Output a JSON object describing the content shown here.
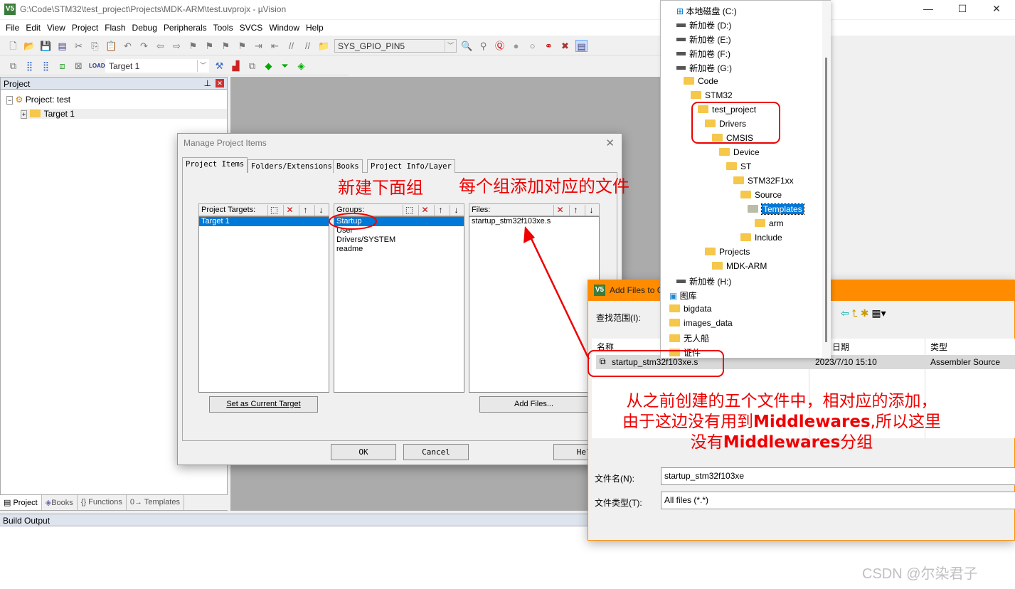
{
  "window": {
    "title": "G:\\Code\\STM32\\test_project\\Projects\\MDK-ARM\\test.uvprojx - µVision",
    "app_icon": "V5",
    "controls": [
      "minimize",
      "maximize",
      "close"
    ]
  },
  "menu": [
    "File",
    "Edit",
    "View",
    "Project",
    "Flash",
    "Debug",
    "Peripherals",
    "Tools",
    "SVCS",
    "Window",
    "Help"
  ],
  "toolbar": {
    "find_combo": "SYS_GPIO_PIN5",
    "target_combo": "Target 1",
    "load_label": "LOAD"
  },
  "project_pane": {
    "title": "Project",
    "root": "Project: test",
    "target": "Target 1",
    "tabs": [
      "Project",
      "Books",
      "{} Functions",
      "0→ Templates"
    ]
  },
  "build_output": {
    "title": "Build Output"
  },
  "manage_dialog": {
    "title": "Manage Project Items",
    "tabs": [
      "Project Items",
      "Folders/Extensions",
      "Books",
      "Project Info/Layer"
    ],
    "targets_label": "Project Targets:",
    "targets": [
      "Target 1"
    ],
    "groups_label": "Groups:",
    "groups": [
      "Startup",
      "User",
      "Drivers/SYSTEM",
      "readme"
    ],
    "files_label": "Files:",
    "files": [
      "startup_stm32f103xe.s"
    ],
    "set_target_btn": "Set as Current Target",
    "add_files_btn": "Add Files...",
    "ok": "OK",
    "cancel": "Cancel",
    "help": "Help"
  },
  "folder_tree": [
    {
      "label": "本地磁盘 (C:)",
      "icon": "windows-drive"
    },
    {
      "label": "新加卷 (D:)",
      "icon": "drive"
    },
    {
      "label": "新加卷 (E:)",
      "icon": "drive"
    },
    {
      "label": "新加卷 (F:)",
      "icon": "drive"
    },
    {
      "label": "新加卷 (G:)",
      "icon": "drive"
    },
    {
      "label": "Code",
      "icon": "folder"
    },
    {
      "label": "STM32",
      "icon": "folder"
    },
    {
      "label": "test_project",
      "icon": "folder"
    },
    {
      "label": "Drivers",
      "icon": "folder"
    },
    {
      "label": "CMSIS",
      "icon": "folder"
    },
    {
      "label": "Device",
      "icon": "folder"
    },
    {
      "label": "ST",
      "icon": "folder"
    },
    {
      "label": "STM32F1xx",
      "icon": "folder"
    },
    {
      "label": "Source",
      "icon": "folder"
    },
    {
      "label": "Templates",
      "icon": "folder-open",
      "selected": true
    },
    {
      "label": "arm",
      "icon": "folder"
    },
    {
      "label": "Include",
      "icon": "folder"
    },
    {
      "label": "Projects",
      "icon": "folder"
    },
    {
      "label": "MDK-ARM",
      "icon": "folder"
    },
    {
      "label": "新加卷 (H:)",
      "icon": "drive"
    },
    {
      "label": "图库",
      "icon": "gallery"
    },
    {
      "label": "bigdata",
      "icon": "folder"
    },
    {
      "label": "images_data",
      "icon": "folder"
    },
    {
      "label": "无人船",
      "icon": "folder"
    },
    {
      "label": "证件",
      "icon": "folder"
    }
  ],
  "add_files_dialog": {
    "title": "Add Files to G",
    "look_in_label": "查找范围(I):",
    "columns": [
      "名称",
      "日期",
      "类型"
    ],
    "rows": [
      {
        "name": "startup_stm32f103xe.s",
        "date": "2023/7/10 15:10",
        "type": "Assembler Source"
      }
    ],
    "filename_label": "文件名(N):",
    "filename_value": "startup_stm32f103xe",
    "filetype_label": "文件类型(T):",
    "filetype_value": "All files (*.*)"
  },
  "annotations": {
    "a1": "新建下面组",
    "a2": "每个组添加对应的文件",
    "a3": [
      "从之前创建的五个文件中，相对应的添加，",
      "由于这边没有用到",
      "Middlewares",
      ",所以这里",
      "没有",
      "Middlewares",
      "分组"
    ],
    "color": "#ff0000"
  },
  "watermark": "CSDN @尔染君子"
}
